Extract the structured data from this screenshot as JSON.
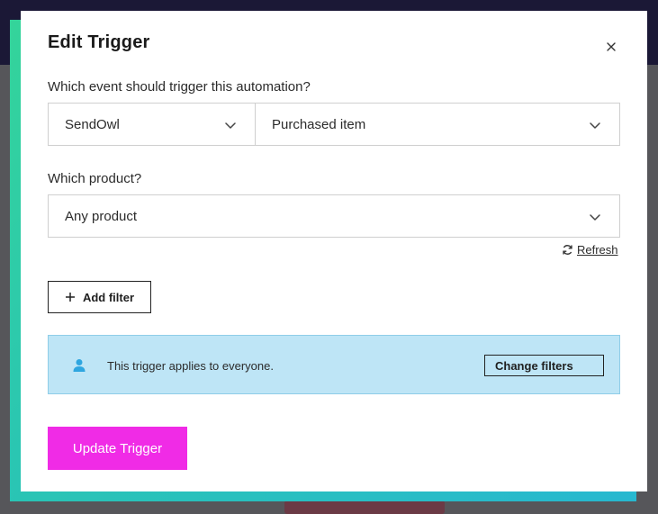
{
  "modal": {
    "title": "Edit Trigger"
  },
  "event_section": {
    "label": "Which event should trigger this automation?",
    "app_select": {
      "value": "SendOwl"
    },
    "event_select": {
      "value": "Purchased item"
    }
  },
  "product_section": {
    "label": "Which product?",
    "product_select": {
      "value": "Any product"
    },
    "refresh_label": "Refresh"
  },
  "filters": {
    "add_filter_label": "Add filter",
    "info_message": "This trigger applies to everyone.",
    "change_filters_label": "Change filters"
  },
  "footer": {
    "update_label": "Update Trigger"
  },
  "colors": {
    "primary_button": "#f02be6",
    "info_background": "#bee5f6",
    "info_icon": "#2ea6e0",
    "accent_frame": "#29c4b5",
    "backdrop": "#56565a"
  },
  "icons": {
    "close": "close-icon",
    "chevron": "chevron-down-icon",
    "refresh": "refresh-icon",
    "plus": "plus-icon",
    "person": "person-icon"
  }
}
